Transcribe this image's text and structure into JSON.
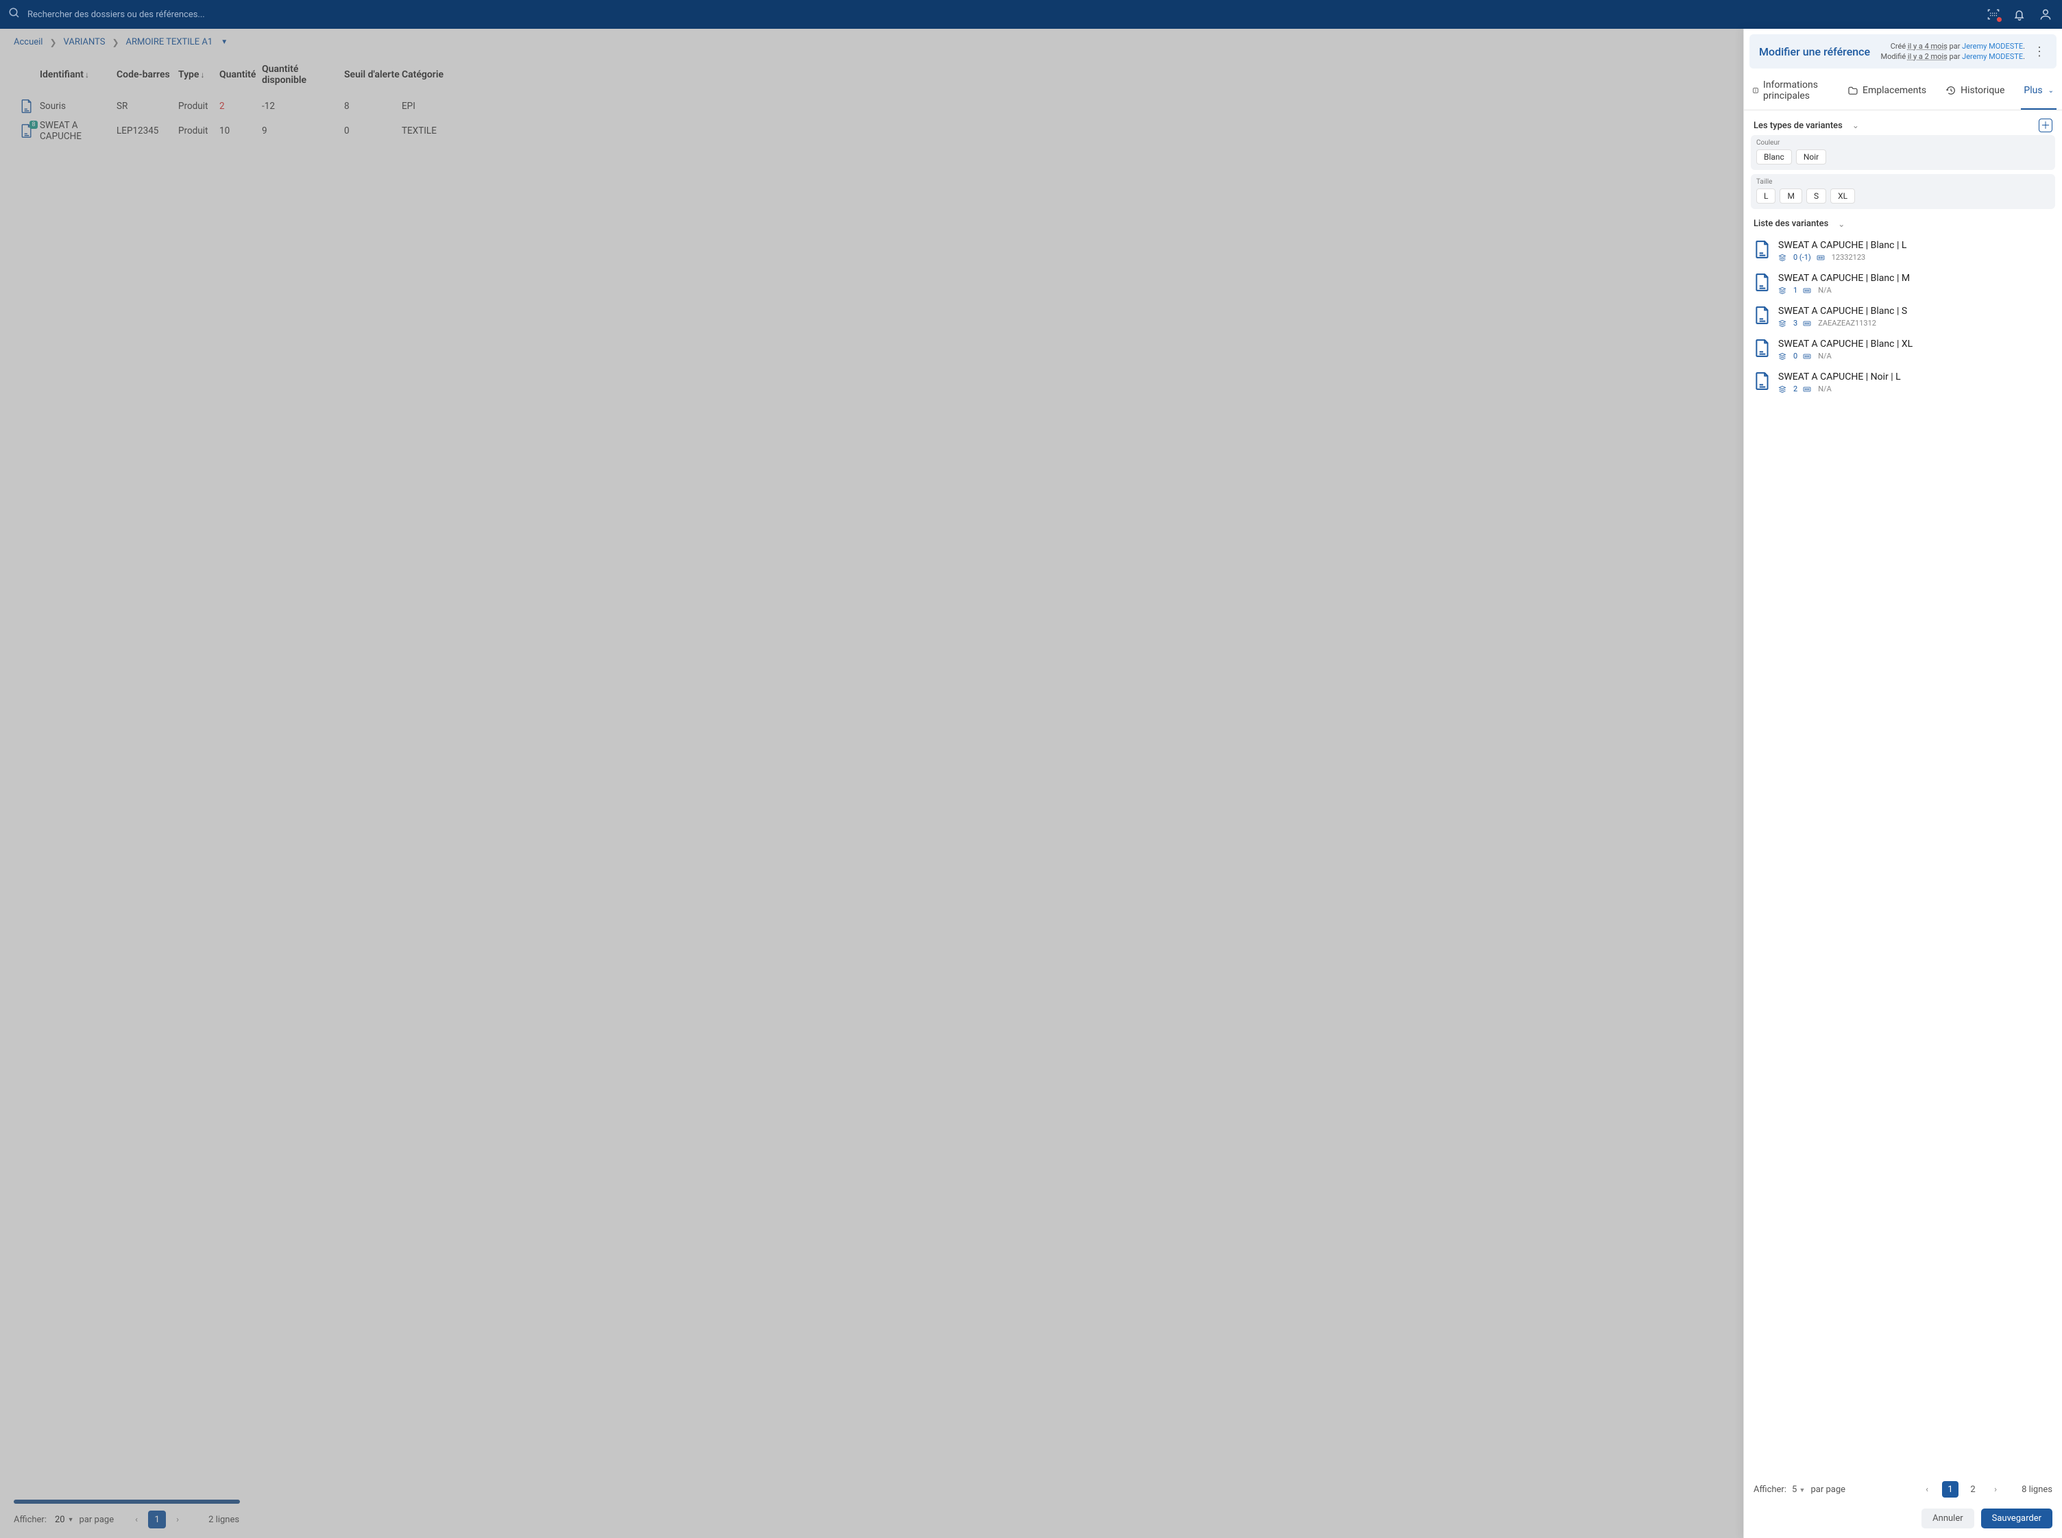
{
  "topbar": {
    "search_placeholder": "Rechercher des dossiers ou des références..."
  },
  "breadcrumb": {
    "items": [
      "Accueil",
      "VARIANTS",
      "ARMOIRE TEXTILE A1"
    ]
  },
  "table": {
    "headers": {
      "id": "Identifiant",
      "barcode": "Code-barres",
      "type": "Type",
      "qty": "Quantité",
      "avail": "Quantité disponible",
      "threshold": "Seuil d'alerte",
      "category": "Catégorie"
    },
    "rows": [
      {
        "id": "Souris",
        "barcode": "SR",
        "type": "Produit",
        "qty": "2",
        "avail": "-12",
        "threshold": "8",
        "category": "EPI",
        "badge": ""
      },
      {
        "id": "SWEAT A CAPUCHE",
        "barcode": "LEP12345",
        "type": "Produit",
        "qty": "10",
        "avail": "9",
        "threshold": "0",
        "category": "TEXTILE",
        "badge": "8"
      }
    ]
  },
  "left_pager": {
    "show_label": "Afficher:",
    "page_size": "20",
    "per_page": "par page",
    "current": "1",
    "total_lines": "2 lignes"
  },
  "panel": {
    "title": "Modifier une référence",
    "created_label": "Créé",
    "created_when": "il y a 4 mois",
    "by": "par",
    "created_user": "Jeremy MODESTE",
    "modified_label": "Modifié",
    "modified_when": "il y a 2 mois",
    "modified_user": "Jeremy MODESTE",
    "tabs": {
      "info": "Informations principales",
      "locations": "Emplacements",
      "history": "Historique",
      "more": "Plus"
    },
    "types_header": "Les types de variantes",
    "groups": [
      {
        "label": "Couleur",
        "chips": [
          "Blanc",
          "Noir"
        ]
      },
      {
        "label": "Taille",
        "chips": [
          "L",
          "M",
          "S",
          "XL"
        ]
      }
    ],
    "list_header": "Liste des variantes",
    "variants": [
      {
        "name": "SWEAT A CAPUCHE | Blanc | L",
        "qty": "0 (-1)",
        "barcode": "12332123"
      },
      {
        "name": "SWEAT A CAPUCHE | Blanc | M",
        "qty": "1",
        "barcode": "N/A"
      },
      {
        "name": "SWEAT A CAPUCHE | Blanc | S",
        "qty": "3",
        "barcode": "ZAEAZEAZ11312"
      },
      {
        "name": "SWEAT A CAPUCHE | Blanc | XL",
        "qty": "0",
        "barcode": "N/A"
      },
      {
        "name": "SWEAT A CAPUCHE | Noir | L",
        "qty": "2",
        "barcode": "N/A"
      }
    ],
    "footer": {
      "show_label": "Afficher:",
      "page_size": "5",
      "per_page": "par page",
      "pages": [
        "1",
        "2"
      ],
      "total_lines": "8 lignes",
      "cancel": "Annuler",
      "save": "Sauvegarder"
    }
  }
}
